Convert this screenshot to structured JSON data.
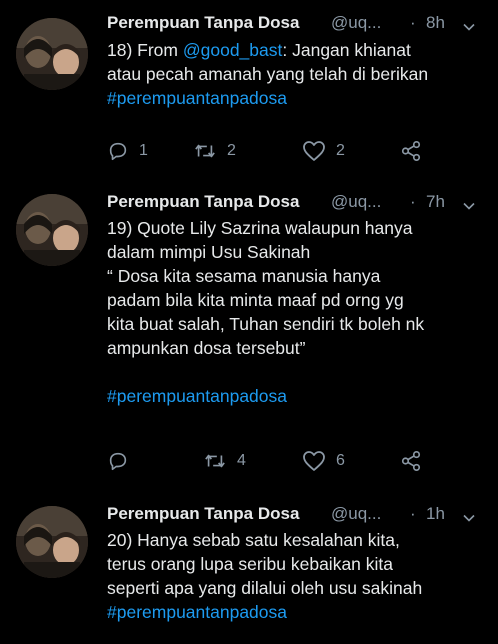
{
  "colors": {
    "background": "#000000",
    "text": "#e7e9ea",
    "secondary": "#8b98a5",
    "link": "#1d9bf0"
  },
  "tweets": [
    {
      "name": "Perempuan Tanpa Dosa",
      "handle": "@uq...",
      "separator": "·",
      "time": "8h",
      "lines": [
        {
          "prefix": "18) From ",
          "mention": "@good_bast",
          "suffix": ": Jangan khianat"
        },
        {
          "text": "atau pecah amanah yang telah di berikan"
        }
      ],
      "hashtag": "#perempuantanpadosa",
      "reply_icon": "reply-icon",
      "replies": "1",
      "retweet_icon": "retweet-icon",
      "retweets": "2",
      "like_icon": "heart-icon",
      "likes": "2",
      "share_icon": "share-icon"
    },
    {
      "name": "Perempuan Tanpa Dosa",
      "handle": "@uq...",
      "separator": "·",
      "time": "7h",
      "lines": [
        {
          "text": "19) Quote Lily Sazrina walaupun hanya"
        },
        {
          "text": "dalam mimpi Usu Sakinah"
        },
        {
          "text": "“ Dosa kita sesama manusia hanya"
        },
        {
          "text": "padam bila kita minta maaf pd orng yg"
        },
        {
          "text": "kita buat salah, Tuhan sendiri tk boleh nk"
        },
        {
          "text": "ampunkan dosa tersebut”"
        }
      ],
      "hashtag": "#perempuantanpadosa",
      "reply_icon": "reply-icon",
      "replies": "",
      "retweet_icon": "retweet-icon",
      "retweets": "4",
      "like_icon": "heart-icon",
      "likes": "6",
      "share_icon": "share-icon"
    },
    {
      "name": "Perempuan Tanpa Dosa",
      "handle": "@uq...",
      "separator": "·",
      "time": "1h",
      "lines": [
        {
          "text": "20) Hanya sebab satu kesalahan kita,"
        },
        {
          "text": "terus orang lupa seribu kebaikan kita"
        },
        {
          "text": "seperti apa yang dilalui oleh usu sakinah"
        }
      ],
      "hashtag": "#perempuantanpadosa"
    }
  ]
}
